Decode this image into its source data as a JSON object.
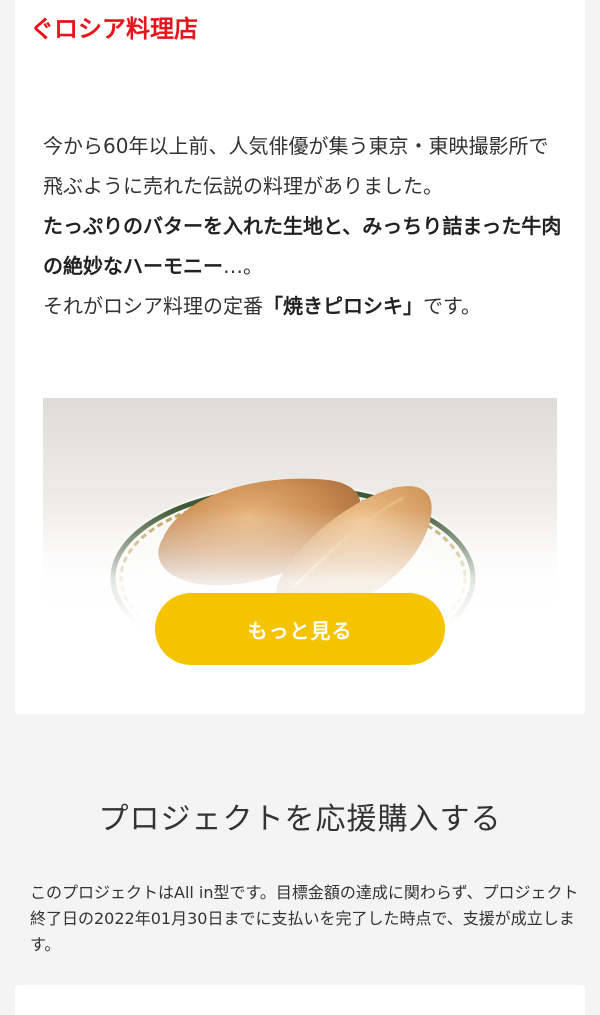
{
  "header": {
    "title": "ぐロシア料理店"
  },
  "story": {
    "line1": "今から60年以上前、人気俳優が集う東京・東映撮影所で飛ぶように売れた伝説の料理がありました。",
    "line2": "たっぷりのバターを入れた生地と、みっちり詰まった牛肉の絶妙なハーモニー",
    "line2_tail": "…。",
    "line3_pre": "それがロシア料理の定番",
    "line3_quote": "「焼きピロシキ」",
    "line3_post": "です。"
  },
  "photo": {
    "icon": "pirozhki-photo"
  },
  "more_button": {
    "label": "もっと見る"
  },
  "purchase": {
    "title": "プロジェクトを応援購入する",
    "description": "このプロジェクトはAll in型です。目標金額の達成に関わらず、プロジェクト終了日の2022年01月30日までに支払いを完了した時点で、支援が成立します。"
  },
  "colors": {
    "accent_red": "#e8141c",
    "button_yellow": "#f5c400",
    "background": "#f4f4f4"
  }
}
